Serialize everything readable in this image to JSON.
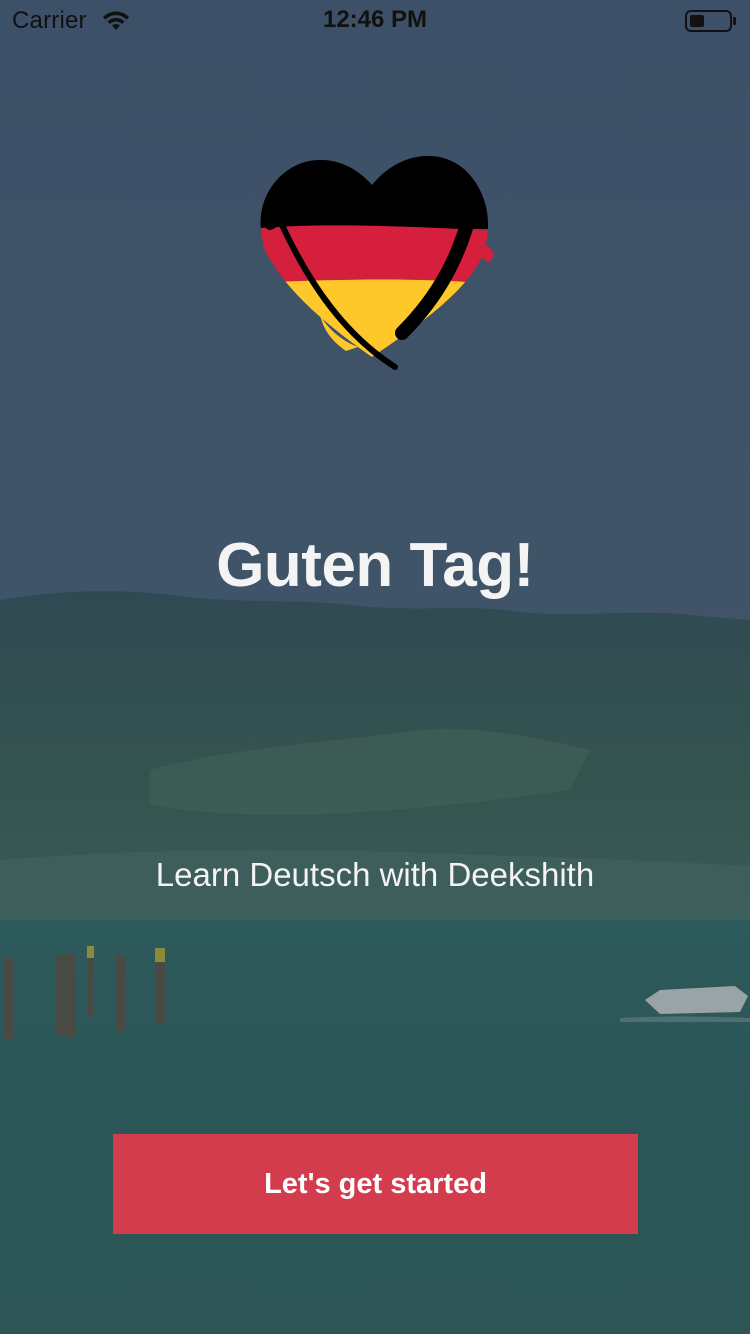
{
  "status_bar": {
    "carrier": "Carrier",
    "time": "12:46 PM",
    "wifi_icon": "wifi-icon",
    "battery_icon": "battery-icon"
  },
  "logo": {
    "icon": "german-flag-heart-icon",
    "colors": [
      "#000000",
      "#d61f3c",
      "#ffc82a"
    ]
  },
  "main": {
    "greeting": "Guten Tag!",
    "tagline": "Learn Deutsch with Deekshith"
  },
  "cta": {
    "label": "Let's get started",
    "color": "#d33c4c"
  },
  "background": {
    "description_icon": "lake-landscape-background"
  }
}
